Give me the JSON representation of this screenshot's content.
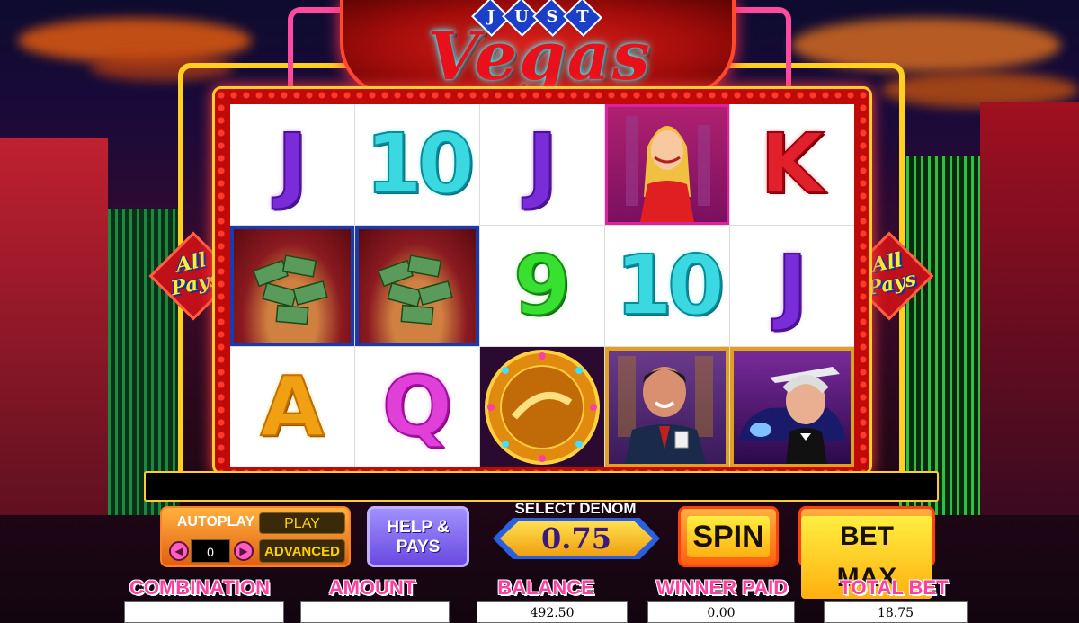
{
  "sign": {
    "just_letters": [
      "J",
      "U",
      "S",
      "T"
    ],
    "title": "Vegas"
  },
  "all_pays": {
    "line1": "All",
    "line2": "Pays"
  },
  "reels": [
    [
      "J",
      "money",
      "A"
    ],
    [
      "10",
      "money",
      "Q"
    ],
    [
      "J",
      "9",
      "vegas-coin"
    ],
    [
      "lady",
      "10",
      "man"
    ],
    [
      "K",
      "J",
      "limo"
    ]
  ],
  "controls": {
    "autoplay_label": "AUTOPLAY",
    "play_label": "PLAY",
    "autoplay_count": "0",
    "advanced_label": "ADVANCED",
    "help_line1": "HELP &",
    "help_line2": "PAYS",
    "denom_label": "SELECT DENOM",
    "denom_value": "0.75",
    "spin_label": "SPIN",
    "bet_max_label": "BET MAX"
  },
  "stats": {
    "combination_label": "COMBINATION",
    "combination_value": "",
    "amount_label": "AMOUNT",
    "amount_value": "",
    "balance_label": "BALANCE",
    "balance_value": "492.50",
    "winner_paid_label": "WINNER PAID",
    "winner_paid_value": "0.00",
    "total_bet_label": "TOTAL BET",
    "total_bet_value": "18.75"
  },
  "colors": {
    "accent_red": "#e0101a",
    "neon_yellow": "#ffcc30",
    "neon_pink": "#ff40a0",
    "button_orange": "#ff8020",
    "help_purple": "#7a5af0"
  }
}
